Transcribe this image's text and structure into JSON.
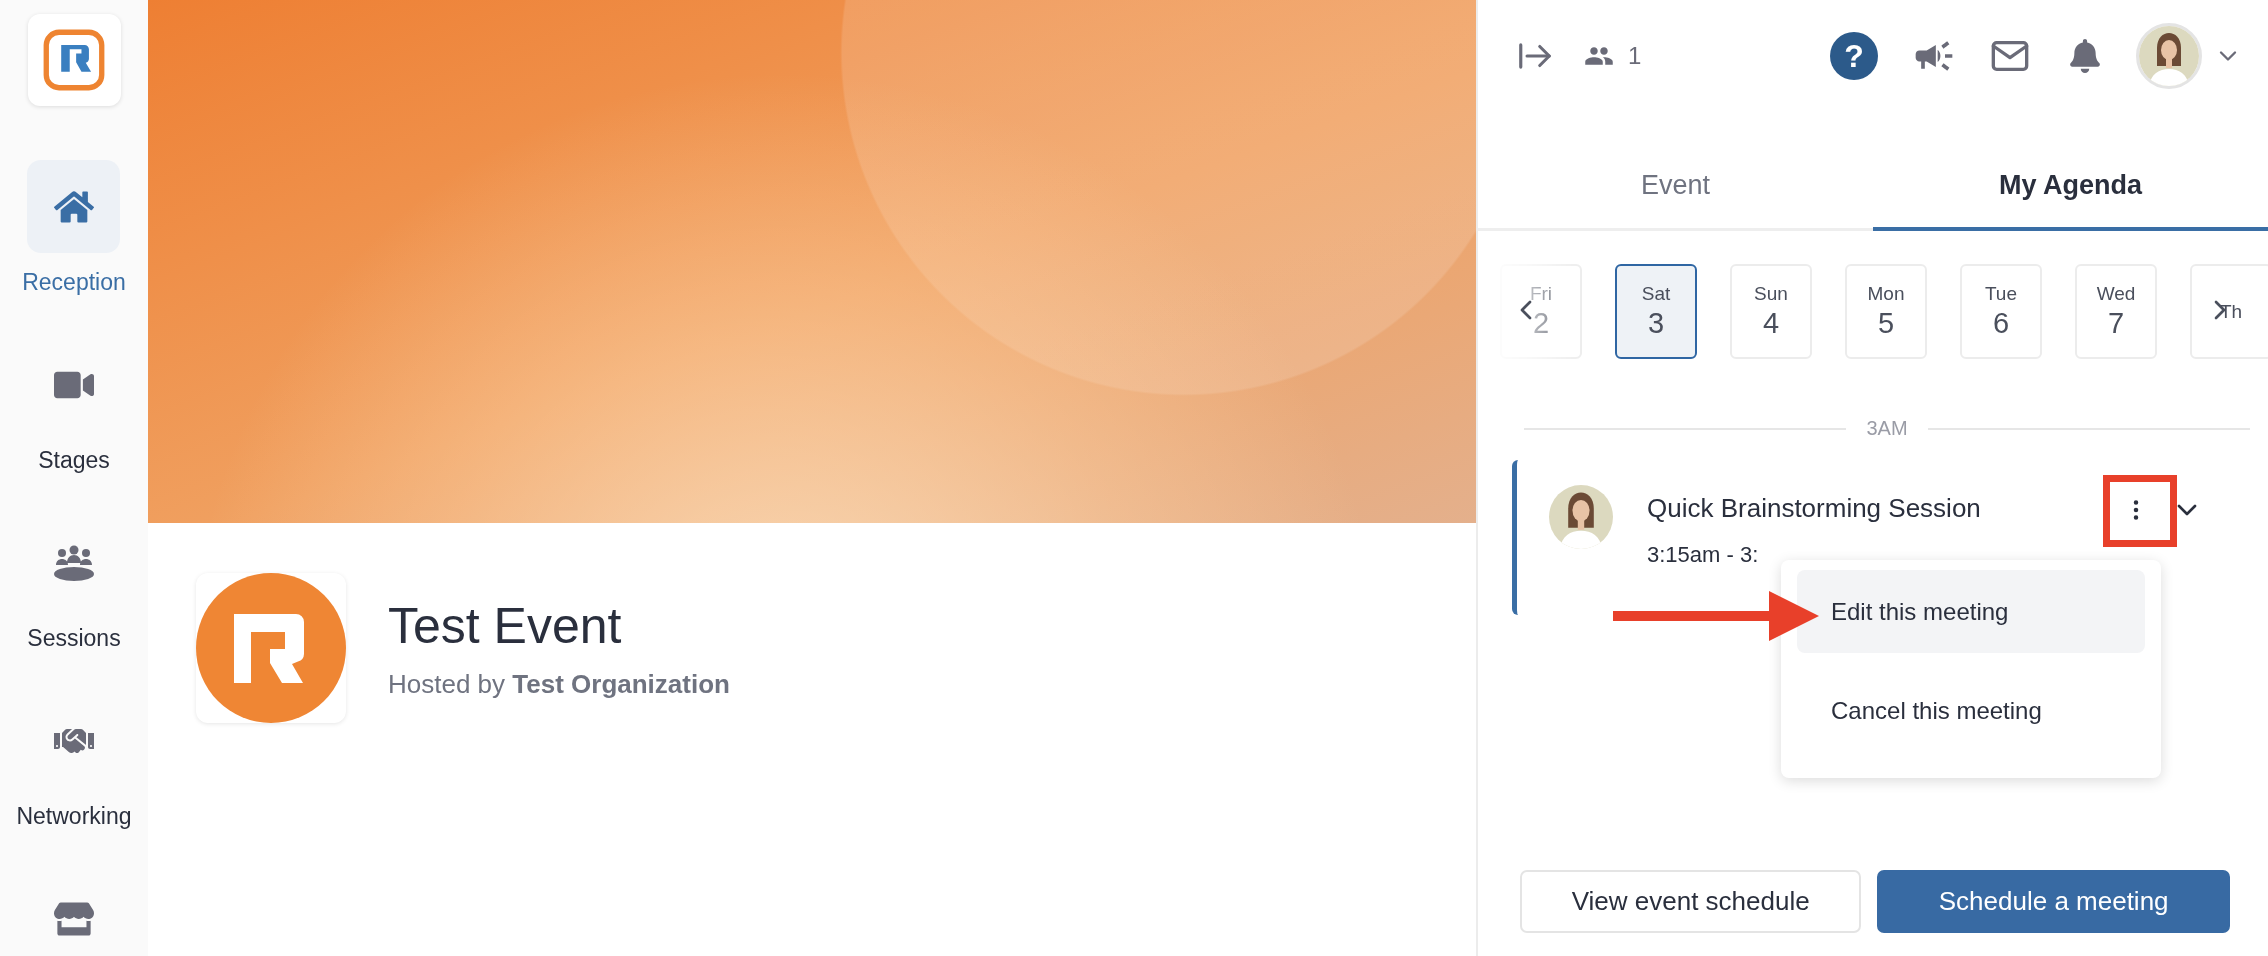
{
  "sidebar": {
    "items": [
      {
        "label": "Reception",
        "kind": "home",
        "selected": true
      },
      {
        "label": "Stages",
        "kind": "video",
        "selected": false
      },
      {
        "label": "Sessions",
        "kind": "sessions",
        "selected": false
      },
      {
        "label": "Networking",
        "kind": "handshake",
        "selected": false
      },
      {
        "kind": "booth",
        "selected": false
      }
    ]
  },
  "event": {
    "title": "Test Event",
    "host_line": "Hosted by **Test Organization**"
  },
  "header": {
    "attendee_count": "1",
    "help_label": "?"
  },
  "tabs": [
    {
      "label": "Event",
      "selected": false
    },
    {
      "label": "My Agenda",
      "selected": true
    }
  ],
  "dates": [
    {
      "day": "Fri",
      "date": "2",
      "selected": false
    },
    {
      "day": "Sat",
      "date": "3",
      "selected": true
    },
    {
      "day": "Sun",
      "date": "4",
      "selected": false
    },
    {
      "day": "Mon",
      "date": "5",
      "selected": false
    },
    {
      "day": "Tue",
      "date": "6",
      "selected": false
    },
    {
      "day": "Wed",
      "date": "7",
      "selected": false
    },
    {
      "day": "Th",
      "selected": false
    }
  ],
  "agenda": {
    "time_marker": "3AM",
    "meetings": [
      {
        "title": "Quick Brainstorming Session",
        "time": "3:15am - 3:"
      }
    ]
  },
  "menu": {
    "items": [
      {
        "label": "Edit this meeting",
        "selected": true
      },
      {
        "label": "Cancel this meeting",
        "selected": false
      }
    ]
  },
  "buttons": [
    {
      "label": "View event schedule",
      "kind": "secondary"
    },
    {
      "label": "Schedule a meeting",
      "kind": "primary"
    }
  ]
}
